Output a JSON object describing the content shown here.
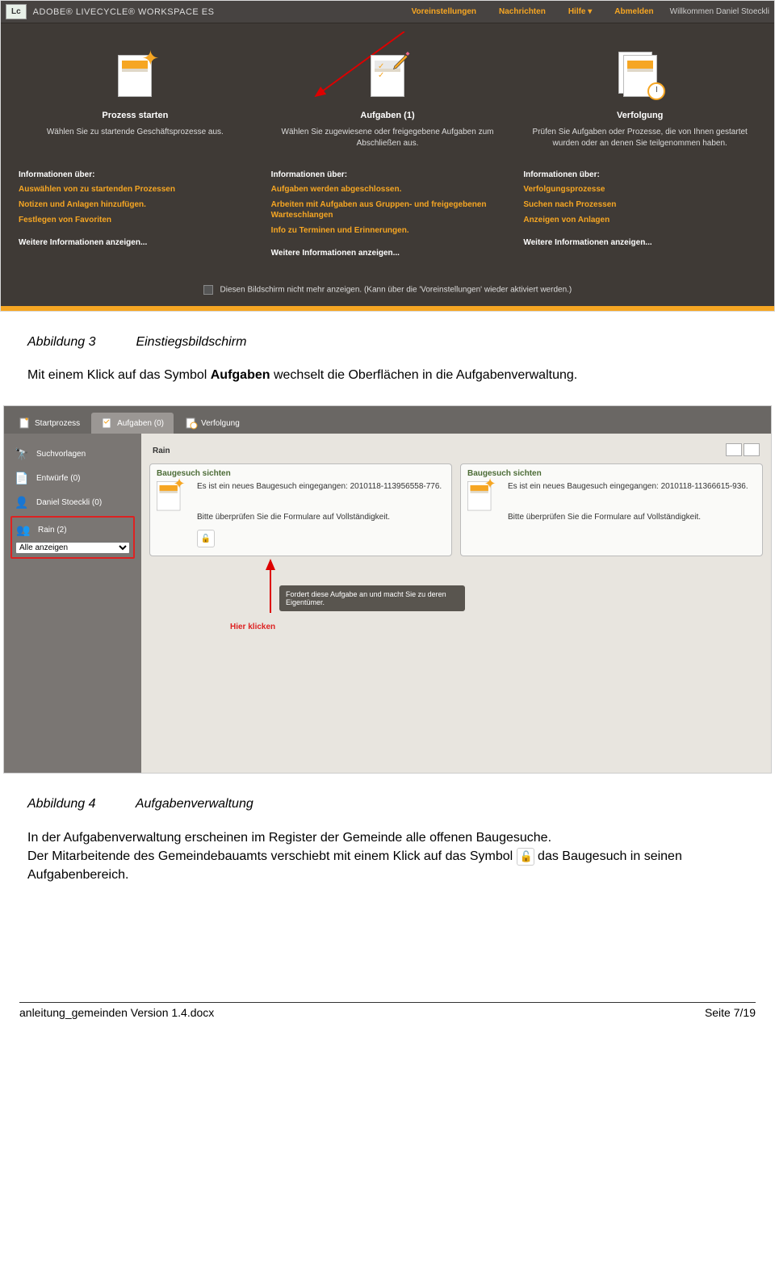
{
  "topbar": {
    "logo": "Lc",
    "brand": "ADOBE® LIVECYCLE® WORKSPACE ES",
    "nav": [
      "Voreinstellungen",
      "Nachrichten",
      "Hilfe ▾",
      "Abmelden"
    ],
    "welcome": "Willkommen Daniel Stoeckli"
  },
  "panels": [
    {
      "title": "Prozess starten",
      "desc": "Wählen Sie zu startende Geschäftsprozesse aus.",
      "info_title": "Informationen über:",
      "items": [
        "Auswählen von zu startenden Prozessen",
        "Notizen und Anlagen hinzufügen.",
        "Festlegen von Favoriten"
      ],
      "more": "Weitere Informationen anzeigen..."
    },
    {
      "title": "Aufgaben (1)",
      "desc": "Wählen Sie zugewiesene oder freigegebene Aufgaben zum Abschließen aus.",
      "info_title": "Informationen über:",
      "items": [
        "Aufgaben werden abgeschlossen.",
        "Arbeiten mit Aufgaben aus Gruppen- und freigegebenen Warteschlangen",
        "Info zu Terminen und Erinnerungen."
      ],
      "more": "Weitere Informationen anzeigen..."
    },
    {
      "title": "Verfolgung",
      "desc": "Prüfen Sie Aufgaben oder Prozesse, die von Ihnen gestartet wurden oder an denen Sie teilgenommen haben.",
      "info_title": "Informationen über:",
      "items": [
        "Verfolgungsprozesse",
        "Suchen nach Prozessen",
        "Anzeigen von Anlagen"
      ],
      "more": "Weitere Informationen anzeigen..."
    }
  ],
  "footer_check": "Diesen Bildschirm nicht mehr anzeigen. (Kann über die 'Voreinstellungen' wieder aktiviert werden.)",
  "doc": {
    "caption3_lbl": "Abbildung 3",
    "caption3_txt": "Einstiegsbildschirm",
    "para1a": "Mit einem Klick auf das Symbol ",
    "para1b": "Aufgaben",
    "para1c": " wechselt die Oberflächen in die Aufgabenverwaltung.",
    "caption4_lbl": "Abbildung 4",
    "caption4_txt": "Aufgabenverwaltung",
    "para2": "In der Aufgabenverwaltung erscheinen im Register der Gemeinde alle offenen Baugesuche.",
    "para3a": "Der Mitarbeitende des Gemeindebauamts verschiebt mit einem Klick auf das Symbol ",
    "para3b": " das Baugesuch in seinen Aufgabenbereich.",
    "footer_left": "anleitung_gemeinden Version 1.4.docx",
    "footer_right": "Seite 7/19"
  },
  "shot2": {
    "tabs": [
      "Startprozess",
      "Aufgaben (0)",
      "Verfolgung"
    ],
    "sidebar": {
      "search": "Suchvorlagen",
      "drafts": "Entwürfe (0)",
      "user": "Daniel Stoeckli (0)",
      "group": "Rain (2)",
      "select": "Alle anzeigen"
    },
    "main_title": "Rain",
    "cards": [
      {
        "title": "Baugesuch sichten",
        "desc": "Es ist ein neues Baugesuch eingegangen: 2010118-113956558-776.",
        "hint": "Bitte überprüfen Sie die Formulare auf Vollständigkeit."
      },
      {
        "title": "Baugesuch sichten",
        "desc": "Es ist ein neues Baugesuch eingegangen: 2010118-11366615-936.",
        "hint": "Bitte überprüfen Sie die Formulare auf Vollständigkeit."
      }
    ],
    "tooltip": "Fordert diese Aufgabe an und macht Sie zu deren Eigentümer.",
    "hier": "Hier klicken"
  }
}
